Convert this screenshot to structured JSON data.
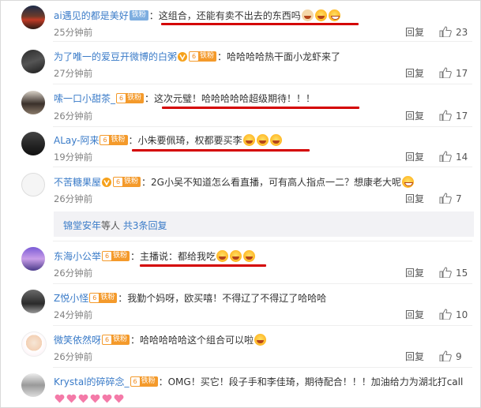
{
  "comments": [
    {
      "user": "ai遇见的都是美好",
      "badge": "铁粉",
      "text": "这组合，还能有卖不出去的东西吗",
      "time": "25分钟前",
      "reply": "回复",
      "likes": "23"
    },
    {
      "user": "为了唯一的爱豆开微博的白粥",
      "badge": "铁粉",
      "text": "哈哈哈哈热干面小龙虾来了",
      "time": "27分钟前",
      "reply": "回复",
      "likes": "17"
    },
    {
      "user": "嗦一口小甜茶_",
      "badge": "铁粉",
      "text": "这次元璧！哈哈哈哈哈超级期待！！！",
      "time": "26分钟前",
      "reply": "回复",
      "likes": "17"
    },
    {
      "user": "ALay-阿来",
      "badge": "铁粉",
      "text": "小朱要佩琦，权都要买李",
      "time": "19分钟前",
      "reply": "回复",
      "likes": "14"
    },
    {
      "user": "不苦糖果屋",
      "badge": "铁粉",
      "text": "2G小吴不知道怎么看直播，可有高人指点一二？想康老大呢",
      "time": "26分钟前",
      "reply": "回复",
      "likes": "7"
    },
    {
      "user": "东海小公举",
      "badge": "铁粉",
      "text": "主播说：都给我吃",
      "time": "26分钟前",
      "reply": "回复",
      "likes": "15"
    },
    {
      "user": "Z悦小怪",
      "badge": "铁粉",
      "text": "我勤个妈呀，欧买嘻！不得辽了不得辽了哈哈哈",
      "time": "24分钟前",
      "reply": "回复",
      "likes": "10"
    },
    {
      "user": "微笑依然呀",
      "badge": "铁粉",
      "text": "哈哈哈哈哈这个组合可以啦",
      "time": "26分钟前",
      "reply": "回复",
      "likes": "9"
    },
    {
      "user": "Krystal的碎碎念_",
      "badge": "铁粉",
      "text": "OMG！买它！段子手和李佳琦，期待配合！！！加油给力为湖北打call"
    }
  ],
  "subreplies": {
    "user": "锦堂安年",
    "middle": "等人",
    "count": "共3条回复"
  },
  "colors": {
    "username": "#3a7bc8",
    "highlight": "#d40000",
    "badge": "#f49a2b"
  }
}
